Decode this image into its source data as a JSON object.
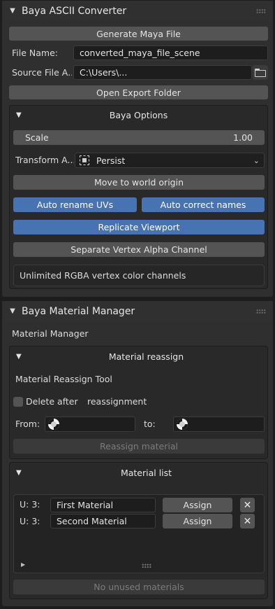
{
  "converter": {
    "title": "Baya ASCII Converter",
    "generate_label": "Generate Maya File",
    "file_name_label": "File Name:",
    "file_name_value": "converted_maya_file_scene",
    "source_label": "Source File A...",
    "source_value": "C:\\Users\\...",
    "open_folder_label": "Open Export Folder",
    "options": {
      "title": "Baya Options",
      "scale_label": "Scale",
      "scale_value": "1.00",
      "transform_label": "Transform A...",
      "transform_value": "Persist",
      "move_origin_label": "Move to world origin",
      "auto_rename_label": "Auto rename UVs",
      "auto_correct_label": "Auto correct names",
      "replicate_label": "Replicate Viewport",
      "separate_label": "Separate Vertex Alpha Channel",
      "info_text": "Unlimited RGBA vertex color channels"
    }
  },
  "material_manager": {
    "title": "Baya Material Manager",
    "subtitle": "Material Manager",
    "reassign": {
      "title": "Material reassign",
      "tool_label": "Material Reassign Tool",
      "delete_label": "Delete after",
      "delete_label2": "reassignment",
      "delete_checked": false,
      "from_label": "From:",
      "to_label": "to:",
      "reassign_button": "Reassign material"
    },
    "list": {
      "title": "Material list",
      "items": [
        {
          "users": "U: 3:",
          "name": "First Material",
          "assign": "Assign"
        },
        {
          "users": "U: 3:",
          "name": "Second Material",
          "assign": "Assign"
        }
      ],
      "no_unused_label": "No unused materials"
    }
  },
  "colors": {
    "accent_blue": "#4772b3",
    "button_gray": "#545454",
    "panel_bg": "#2f2f2f"
  },
  "icons": [
    "collapse-triangle-icon",
    "drag-grip-icon",
    "folder-icon",
    "transform-pivot-icon",
    "chevron-down-icon",
    "material-ball-icon",
    "close-icon",
    "expand-arrow-icon"
  ]
}
